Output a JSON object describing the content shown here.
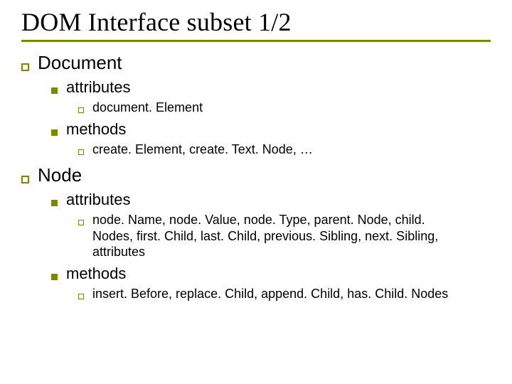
{
  "title": "DOM Interface subset 1/2",
  "items": [
    {
      "label": "Document",
      "children": [
        {
          "label": "attributes",
          "children": [
            {
              "label": "document. Element"
            }
          ]
        },
        {
          "label": "methods",
          "children": [
            {
              "label": "create. Element, create. Text. Node, …"
            }
          ]
        }
      ]
    },
    {
      "label": "Node",
      "children": [
        {
          "label": "attributes",
          "children": [
            {
              "label": "node. Name, node. Value, node. Type, parent. Node, child. Nodes, first. Child, last. Child, previous. Sibling, next. Sibling, attributes"
            }
          ]
        },
        {
          "label": "methods",
          "children": [
            {
              "label": "insert. Before, replace. Child, append. Child, has. Child. Nodes"
            }
          ]
        }
      ]
    }
  ]
}
